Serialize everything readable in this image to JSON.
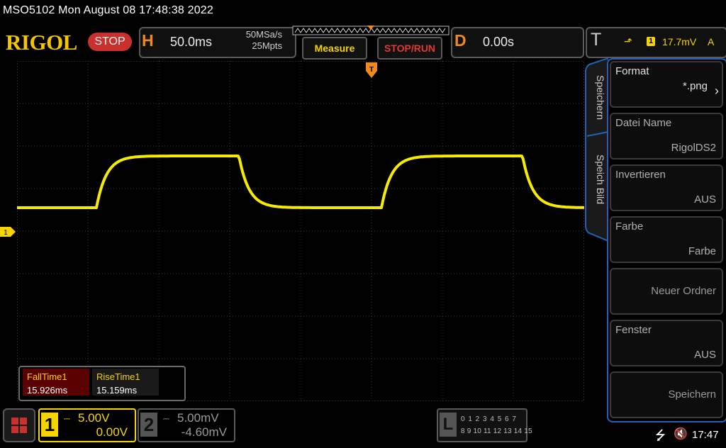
{
  "title_bar": {
    "text": "MSO5102  Mon August 08 17:48:38 2022"
  },
  "brand": {
    "logo": "RIGOL",
    "run_state": "STOP"
  },
  "horizontal": {
    "letter": "H",
    "time_base": "50.0ms",
    "sample_rate": "50MSa/s",
    "memory_depth": "25Mpts"
  },
  "buttons": {
    "measure": "Measure",
    "stop_run": "STOP/RUN"
  },
  "delay": {
    "letter": "D",
    "value": "0.00s"
  },
  "trigger": {
    "letter": "T",
    "source": "1",
    "level": "17.7mV",
    "coupling": "A"
  },
  "channel_marker": "1",
  "measurements": [
    {
      "name": "FallTime1",
      "value": "15.926ms"
    },
    {
      "name": "RiseTime1",
      "value": "15.159ms"
    }
  ],
  "menu": {
    "tabs": [
      "Speichern",
      "Speich Bild"
    ],
    "items": [
      {
        "label": "Format",
        "value": "*.png"
      },
      {
        "label": "Datei Name",
        "value": "RigolDS2"
      },
      {
        "label": "Invertieren",
        "value": "AUS"
      },
      {
        "label": "Farbe",
        "value": "Farbe"
      },
      {
        "label": "",
        "value": "Neuer Ordner"
      },
      {
        "label": "Fenster",
        "value": "AUS"
      },
      {
        "label": "",
        "value": "Speichern"
      }
    ]
  },
  "channels": [
    {
      "num": "1",
      "scale": "5.00V",
      "offset": "0.00V",
      "color": "#f5d400"
    },
    {
      "num": "2",
      "scale": "5.00mV",
      "offset": "-4.60mV",
      "color": "#9a9a9a"
    }
  ],
  "logic": {
    "letter": "L",
    "row1": "0 1 2 3   4 5 6 7",
    "row2": "8 9 10 11  12 13 14 15"
  },
  "status": {
    "clock": "17:47",
    "usb_icon": "usb-icon",
    "speaker_icon": "speaker-muted-icon"
  },
  "colors": {
    "trace": "#f5ea00",
    "accent_orange": "#f08a1a",
    "menu_border": "#1e63b8",
    "grid": "#3a3a3a"
  }
}
